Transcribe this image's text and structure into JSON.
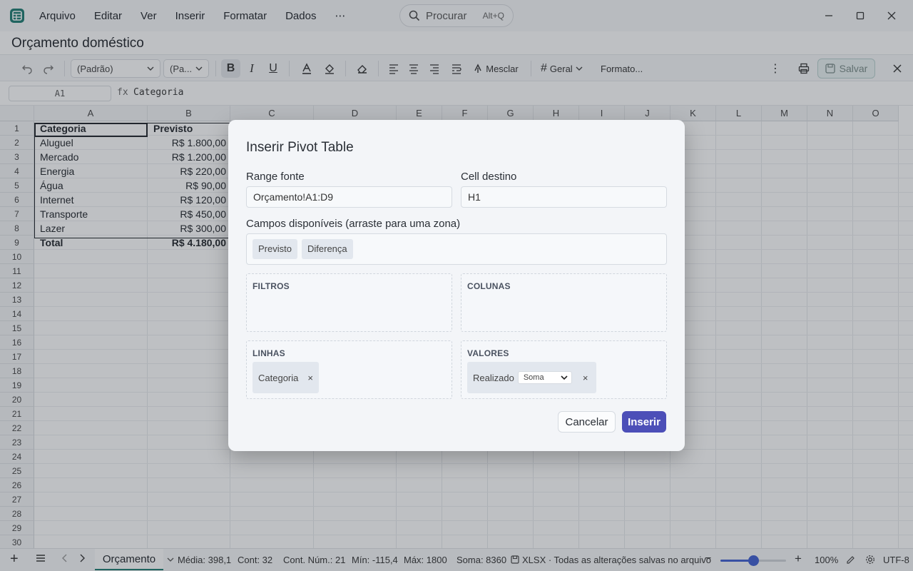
{
  "menu": {
    "items": [
      "Arquivo",
      "Editar",
      "Ver",
      "Inserir",
      "Formatar",
      "Dados",
      "⋯"
    ],
    "search_placeholder": "Procurar",
    "search_shortcut": "Alt+Q"
  },
  "document": {
    "title": "Orçamento doméstico"
  },
  "toolbar": {
    "font_family": "(Padrão)",
    "font_size": "(Pa...",
    "merge_label": "Mesclar",
    "number_format": "Geral",
    "format_more": "Formato...",
    "save_label": "Salvar"
  },
  "formula_bar": {
    "cell_ref": "A1",
    "fx": "fx",
    "formula": "Categoria"
  },
  "sheet": {
    "columns": [
      "A",
      "B",
      "C",
      "D",
      "E",
      "F",
      "G",
      "H",
      "I",
      "J",
      "K",
      "L",
      "M",
      "N",
      "O"
    ],
    "rows": [
      "1",
      "2",
      "3",
      "4",
      "5",
      "6",
      "7",
      "8",
      "9",
      "10",
      "11",
      "12",
      "13",
      "14",
      "15",
      "16",
      "17",
      "18",
      "19",
      "20",
      "21",
      "22",
      "23",
      "24",
      "25",
      "26",
      "27",
      "28",
      "29",
      "30"
    ],
    "data": [
      [
        "Categoria",
        "Previsto"
      ],
      [
        "Aluguel",
        "R$ 1.800,00"
      ],
      [
        "Mercado",
        "R$ 1.200,00"
      ],
      [
        "Energia",
        "R$ 220,00"
      ],
      [
        "Água",
        "R$ 90,00"
      ],
      [
        "Internet",
        "R$ 120,00"
      ],
      [
        "Transporte",
        "R$ 450,00"
      ],
      [
        "Lazer",
        "R$ 300,00"
      ],
      [
        "Total",
        "R$ 4.180,00"
      ]
    ]
  },
  "dialog": {
    "title": "Inserir Pivot Table",
    "range_label": "Range fonte",
    "range_value": "Orçamento!A1:D9",
    "dest_label": "Cell destino",
    "dest_value": "H1",
    "fields_label": "Campos disponíveis (arraste para uma zona)",
    "available_fields": [
      "Previsto",
      "Diferença"
    ],
    "zones": {
      "filters": {
        "title": "FILTROS"
      },
      "columns": {
        "title": "COLUNAS"
      },
      "rows": {
        "title": "LINHAS",
        "field": "Categoria"
      },
      "values": {
        "title": "VALORES",
        "field": "Realizado",
        "aggregation": "Soma"
      }
    },
    "remove_glyph": "×",
    "cancel_label": "Cancelar",
    "insert_label": "Inserir"
  },
  "status": {
    "sheet_tab": "Orçamento",
    "media": "Média: 398,1",
    "cont": "Cont: 32",
    "cont_num": "Cont. Núm.: 21",
    "min": "Mín: -115,4",
    "max": "Máx: 1800",
    "soma": "Soma: 8360",
    "file_status": "XLSX · Todas as alterações salvas no arquivo",
    "zoom": "100%",
    "zoom_fraction": 0.5,
    "encoding": "UTF-8"
  },
  "colors": {
    "accent": "#4c4fb8",
    "brand": "#1e7c72",
    "slider": "#3f5fd1"
  }
}
